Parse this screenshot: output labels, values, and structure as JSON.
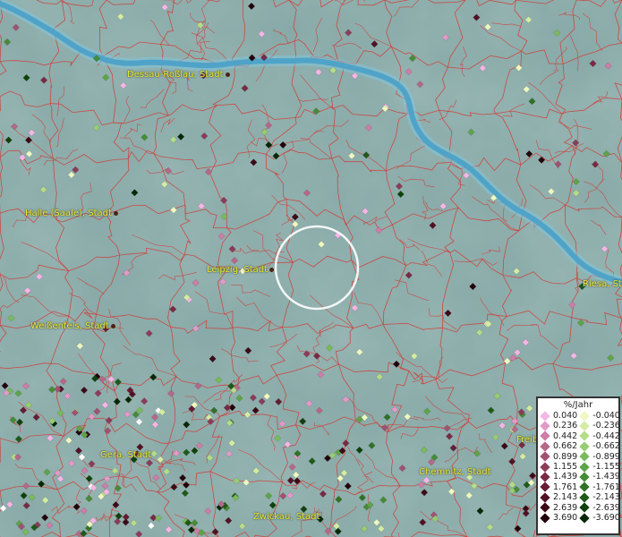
{
  "cities": [
    {
      "id": "dessau",
      "label": "Dessau-Roßlau, Stadt"
    },
    {
      "id": "halle",
      "label": "Halle (Saale), Stadt"
    },
    {
      "id": "leipzig",
      "label": "Leipzig, Stadt"
    },
    {
      "id": "weissenfels",
      "label": "Weißenfels, Stadt"
    },
    {
      "id": "riesa",
      "label": "Riesa, St"
    },
    {
      "id": "gera",
      "label": "Gera, Stadt"
    },
    {
      "id": "chemnitz",
      "label": "Chemnitz, Stadt"
    },
    {
      "id": "zwickau",
      "label": "Zwickau, Stadt"
    },
    {
      "id": "freiberg",
      "label": "Freib"
    }
  ],
  "legend": {
    "title": "%/Jahr",
    "positive": [
      {
        "label": "0.040",
        "color": "#f4b6e4"
      },
      {
        "label": "0.236",
        "color": "#e29ac8"
      },
      {
        "label": "0.442",
        "color": "#cc7ea8"
      },
      {
        "label": "0.662",
        "color": "#b6688a"
      },
      {
        "label": "0.899",
        "color": "#a05272"
      },
      {
        "label": "1.155",
        "color": "#8c3c5a"
      },
      {
        "label": "1.439",
        "color": "#782a44"
      },
      {
        "label": "1.761",
        "color": "#661c32"
      },
      {
        "label": "2.143",
        "color": "#521224"
      },
      {
        "label": "2.639",
        "color": "#3c0a16"
      },
      {
        "label": "3.690",
        "color": "#22040a"
      }
    ],
    "negative": [
      {
        "label": "-0.040",
        "color": "#eef8c0"
      },
      {
        "label": "-0.236",
        "color": "#d4eca2"
      },
      {
        "label": "-0.442",
        "color": "#b6dc88"
      },
      {
        "label": "-0.662",
        "color": "#98cc72"
      },
      {
        "label": "-0.899",
        "color": "#7aba5c"
      },
      {
        "label": "-1.155",
        "color": "#5ea448"
      },
      {
        "label": "-1.439",
        "color": "#468c36"
      },
      {
        "label": "-1.761",
        "color": "#307226"
      },
      {
        "label": "-2.143",
        "color": "#1e5a18"
      },
      {
        "label": "-2.639",
        "color": "#10420c"
      },
      {
        "label": "-3.690",
        "color": "#062806"
      }
    ]
  },
  "colors": {
    "background": "#86a8a6",
    "river": "#4fa3c8",
    "boundary": "#d23a32",
    "city_label": "#f0e830",
    "focus_circle": "#ffffff"
  }
}
